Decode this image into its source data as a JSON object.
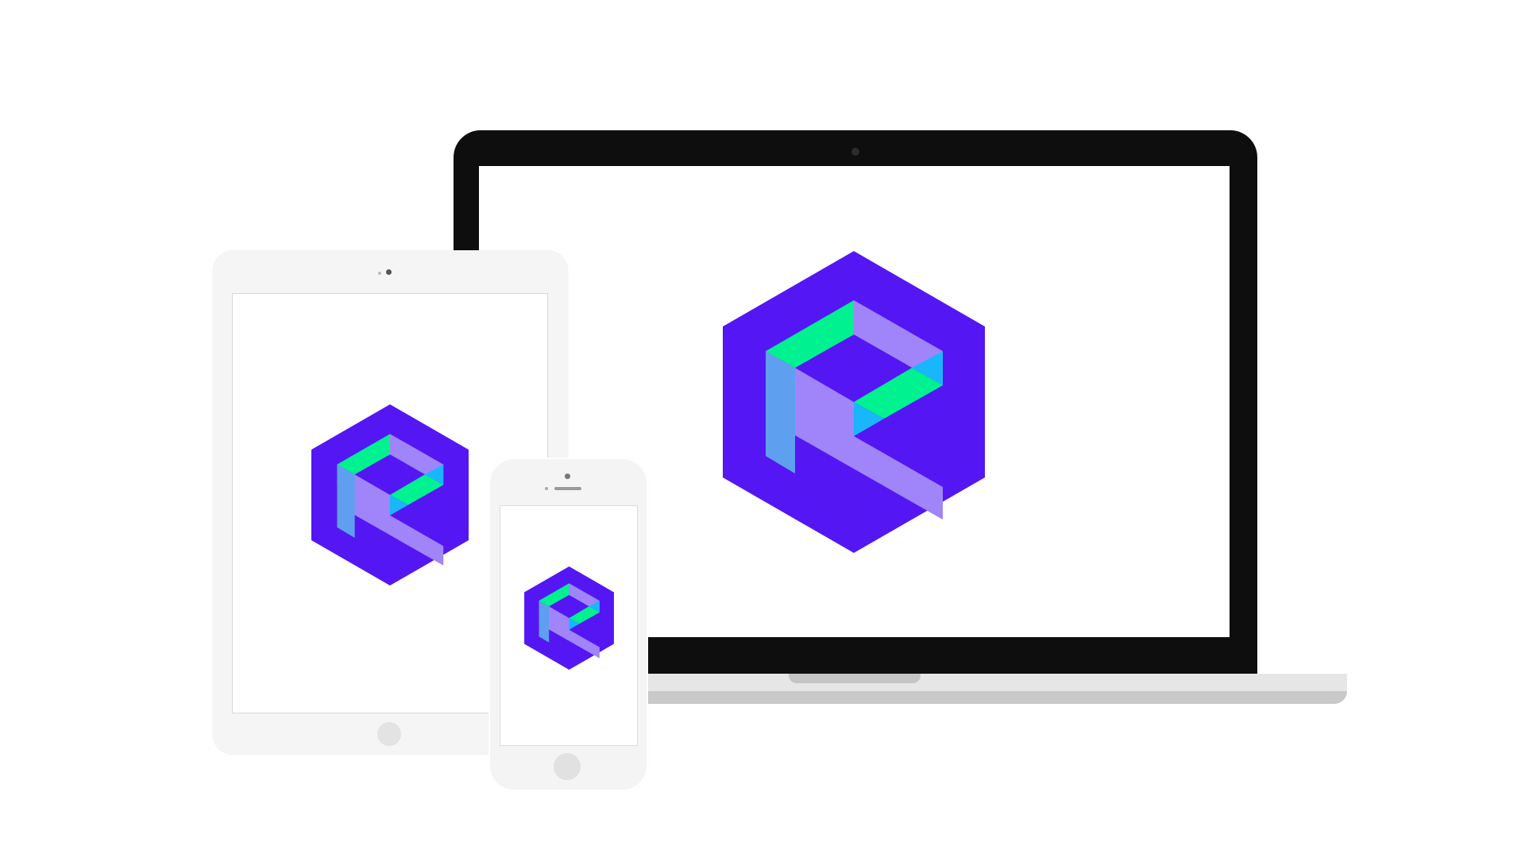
{
  "scene": {
    "devices": [
      "laptop",
      "tablet",
      "phone"
    ],
    "logo": {
      "name": "hexagon-p-logo",
      "colors": {
        "hexagon": "#5417f3",
        "green": "#00f18f",
        "cyan": "#19b6fc",
        "lavender": "#a085fa",
        "blue": "#5ea0ef"
      }
    },
    "device_colors": {
      "laptop_bezel": "#0e0e0e",
      "laptop_base": "#e6e6e6",
      "tablet_body": "#f5f5f5",
      "phone_body": "#f4f4f4",
      "screen": "#ffffff"
    }
  }
}
